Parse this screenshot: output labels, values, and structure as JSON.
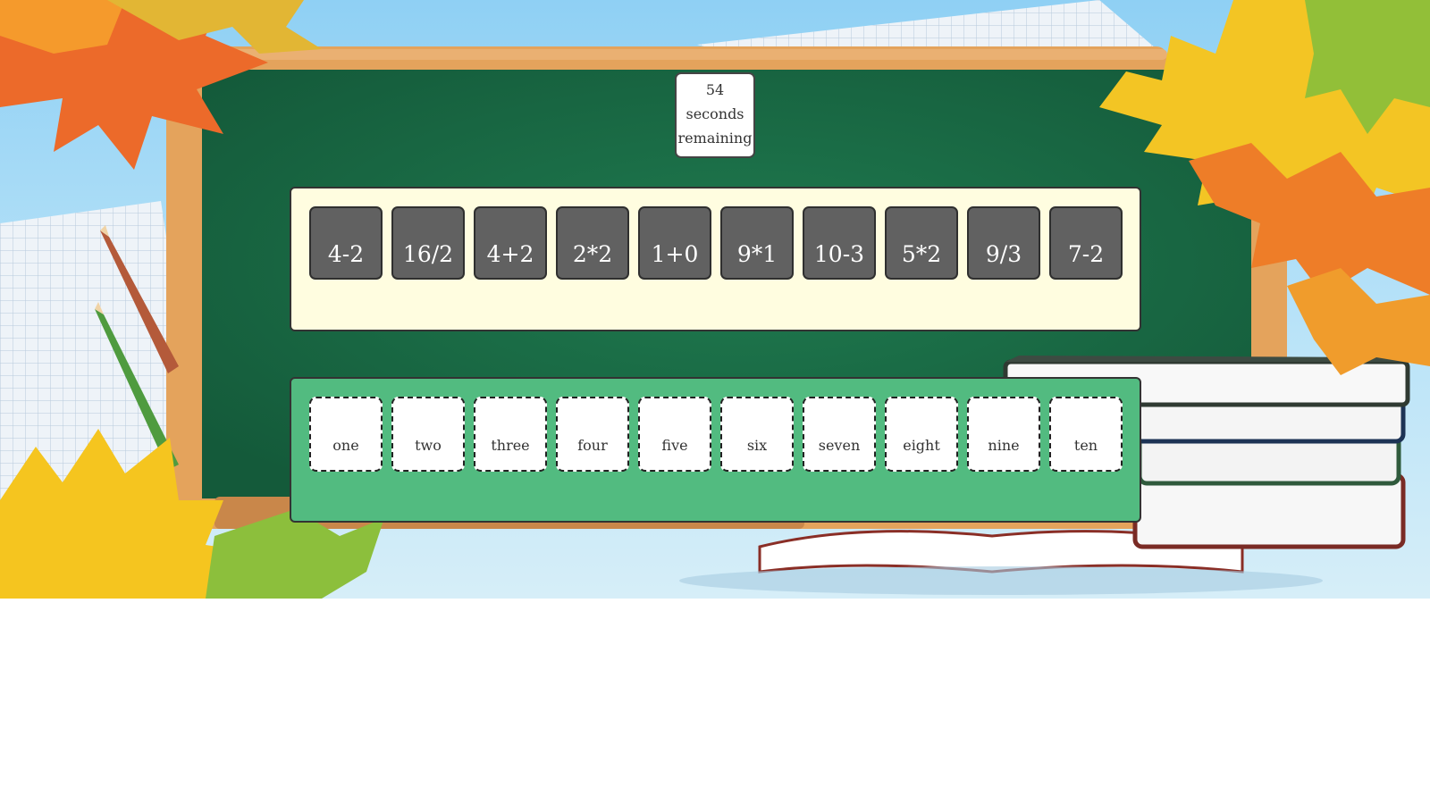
{
  "timer": {
    "value": "54",
    "unit": "seconds",
    "label": "remaining"
  },
  "expressions": [
    "4-2",
    "16/2",
    "4+2",
    "2*2",
    "1+0",
    "9*1",
    "10-3",
    "5*2",
    "9/3",
    "7-2"
  ],
  "answers": [
    "one",
    "two",
    "three",
    "four",
    "five",
    "six",
    "seven",
    "eight",
    "nine",
    "ten"
  ],
  "colors": {
    "chalkboard": "#196b45",
    "board_frame": "#e0a35a",
    "expression_panel": "#fffde0",
    "expression_tile": "#616161",
    "answer_panel": "#52bb80",
    "answer_tile": "#ffffff"
  }
}
